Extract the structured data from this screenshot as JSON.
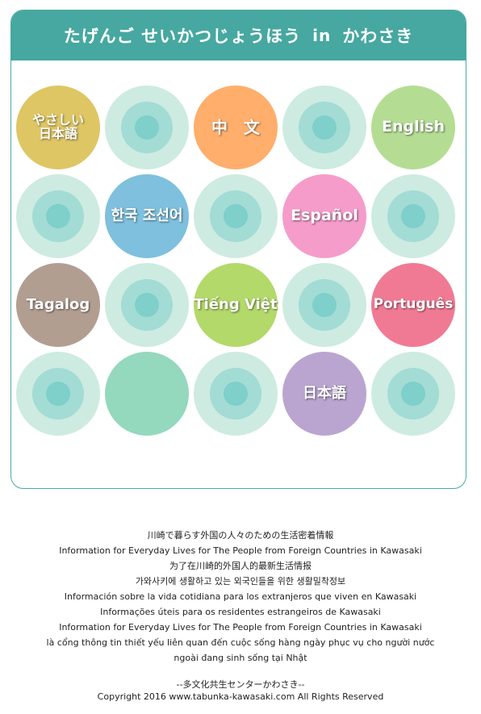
{
  "header": {
    "title_left": "たげんご せいかつじょうほう",
    "title_in": "in",
    "title_right": "かわさき"
  },
  "languages": {
    "easy_japanese": {
      "line1": "やさしい",
      "line2": "日本語",
      "color": "#dfc664"
    },
    "chinese": {
      "label": "中　文",
      "color": "#ffae6b"
    },
    "english": {
      "label": "English",
      "color": "#b4dd93"
    },
    "korean": {
      "label": "한국 조선어",
      "color": "#7ec0dd"
    },
    "spanish": {
      "label": "Español",
      "color": "#f59ccb"
    },
    "tagalog": {
      "label": "Tagalog",
      "color": "#b29e91"
    },
    "vietnamese": {
      "label": "Tiếng Việt",
      "color": "#b3d96a"
    },
    "portuguese": {
      "label": "Português",
      "color": "#f07a93"
    },
    "japanese": {
      "label": "日本語",
      "color": "#baa5d0"
    }
  },
  "footer": {
    "lines": [
      "川崎で暮らす外国の人々のための生活密着情報",
      "Information for Everyday Lives for The People from Foreign Countries in Kawasaki",
      "为了在川崎的外国人的最新生活情报",
      "가와사키에 생활하고 있는 외국인들을 위한 생활밀착정보",
      "Información sobre la vida cotidiana para los extranjeros que viven en Kawasaki",
      "Informações úteis para os residentes estrangeiros de Kawasaki",
      "Information for Everyday Lives for The People from Foreign Countries in Kawasaki",
      "là cổng thông tin thiết yếu liên quan đến cuộc sống hàng ngày phục vụ cho người nước",
      "ngoài đang sinh sống tại Nhật"
    ],
    "org": "--多文化共生センターかわさき--",
    "copyright": "Copyright 2016  www.tabunka-kawasaki.com All Rights Reserved"
  }
}
